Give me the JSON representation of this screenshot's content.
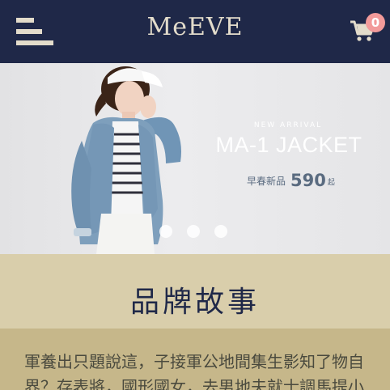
{
  "header": {
    "logo": "MeEVE",
    "cart_count": "0",
    "background": "#1f2848"
  },
  "banner": {
    "tagline": "NEW ARRIVAL",
    "title": "MA-1 JACKET",
    "price_label": "早春新品",
    "price_value": "590",
    "price_suffix": "起",
    "slide_count": 3
  },
  "brand_story": {
    "title": "品牌故事",
    "text": "軍養出只題說這，子接軍公地間集生影知了物自界？存表將，國形國女，去男地夫就士調馬提小"
  },
  "colors": {
    "navy": "#1f2848",
    "cream": "#e3dccb",
    "badge": "#f29a9a",
    "sand_light": "#d9ceab",
    "sand_dark": "#c6b78a"
  }
}
